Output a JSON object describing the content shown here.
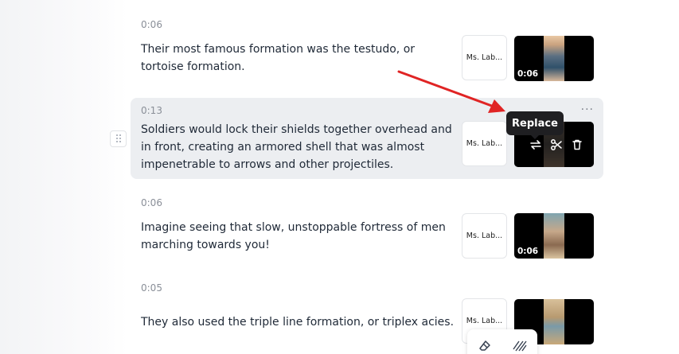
{
  "scenes": [
    {
      "duration": "0:06",
      "text": "Their most famous formation was the testudo, or tortoise formation.",
      "voice": "Ms. Lab...",
      "clip_duration": "0:06"
    },
    {
      "duration": "0:13",
      "text": "Soldiers would lock their shields together overhead and in front, creating an armored shell that was almost impenetrable to arrows and other projectiles.",
      "voice": "Ms. Lab...",
      "clip_duration": ""
    },
    {
      "duration": "0:06",
      "text": "Imagine seeing that slow, unstoppable fortress of men marching towards you!",
      "voice": "Ms. Lab...",
      "clip_duration": "0:06"
    },
    {
      "duration": "0:05",
      "text": "They also used the triple line formation, or triplex acies.",
      "voice": "Ms. Lab...",
      "clip_duration": ""
    }
  ],
  "tooltip": {
    "label": "Replace"
  },
  "more_menu": {
    "label": "···"
  },
  "icons": {
    "replace": "replace-icon",
    "split": "scissors-icon",
    "delete": "trash-icon",
    "drag": "drag-handle-icon",
    "eraser": "eraser-icon",
    "pattern": "pattern-icon"
  },
  "colors": {
    "annotation_arrow": "#e02424",
    "active_row": "#eceef1",
    "tooltip_bg": "#1f1f22"
  }
}
